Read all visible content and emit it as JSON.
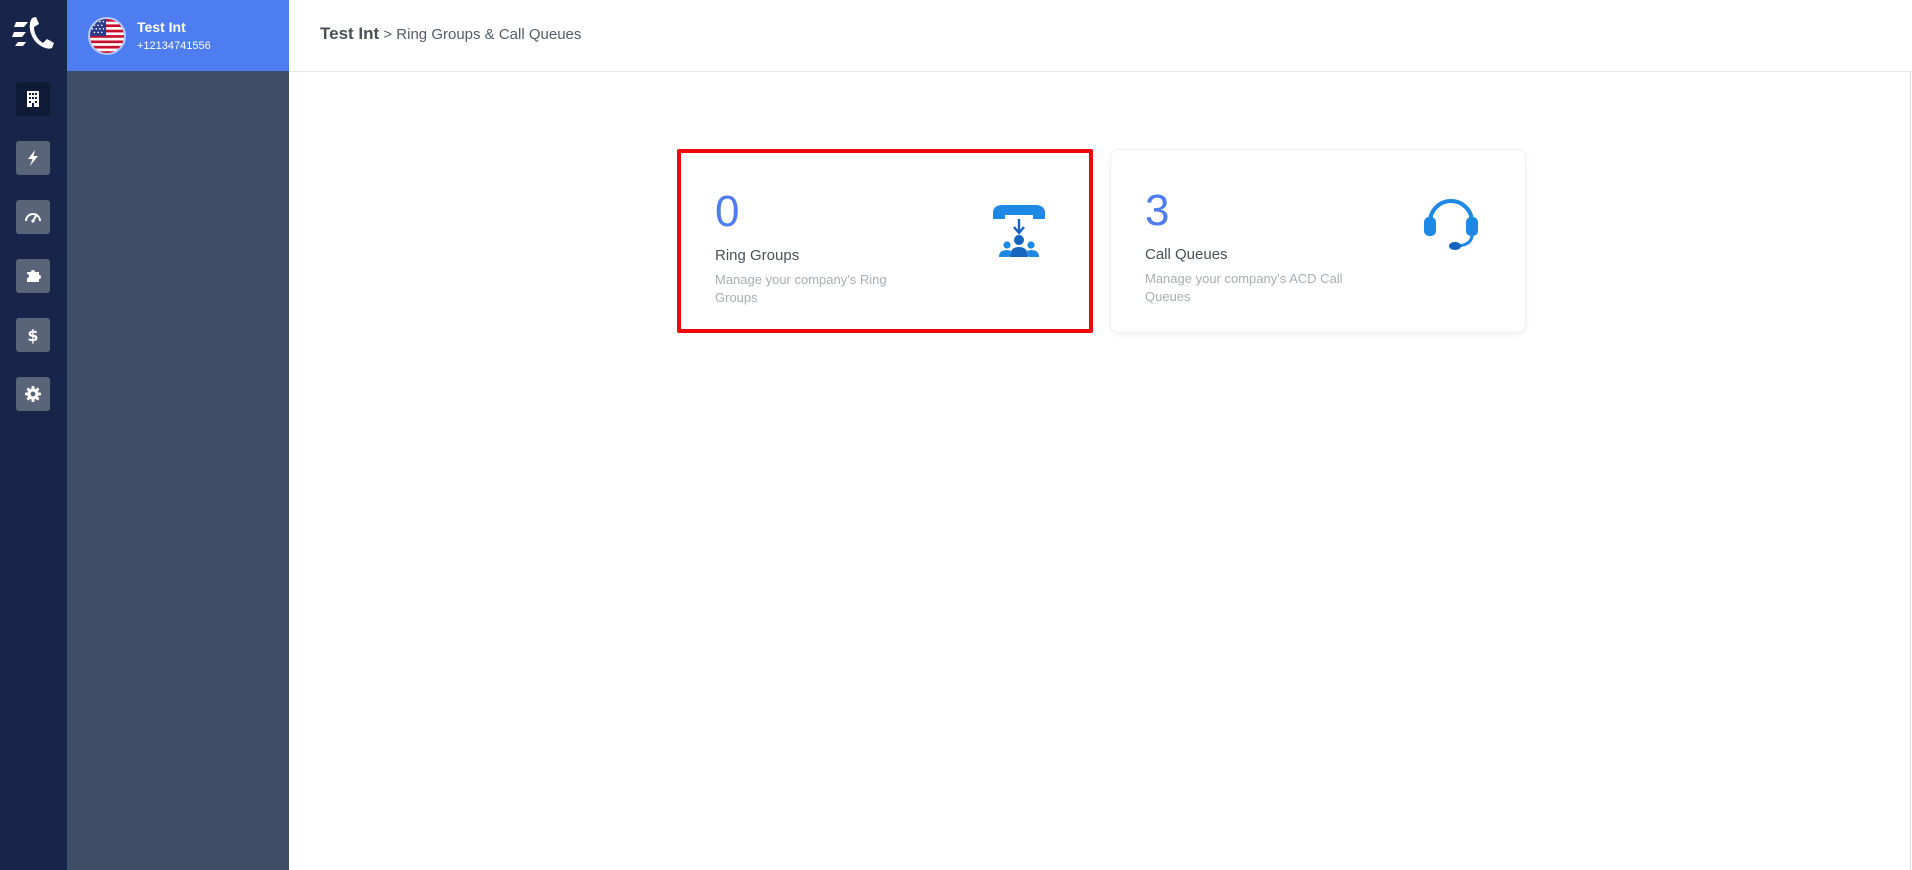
{
  "account": {
    "name": "Test Int",
    "phone": "+12134741556"
  },
  "breadcrumb": {
    "root": "Test Int",
    "separator": " > ",
    "current": "Ring Groups & Call Queues"
  },
  "rail": {
    "items": [
      {
        "icon": "building-icon",
        "active": true
      },
      {
        "icon": "lightning-icon",
        "active": false
      },
      {
        "icon": "speedometer-icon",
        "active": false
      },
      {
        "icon": "puzzle-icon",
        "active": false
      },
      {
        "icon": "dollar-icon",
        "active": false
      },
      {
        "icon": "gear-icon",
        "active": false
      }
    ]
  },
  "cards": [
    {
      "count": "0",
      "title": "Ring Groups",
      "description": "Manage your company's Ring Groups",
      "icon": "ring-group-icon",
      "highlighted": true
    },
    {
      "count": "3",
      "title": "Call Queues",
      "description": "Manage your company's ACD Call Queues",
      "icon": "headset-icon",
      "highlighted": false
    }
  ],
  "colors": {
    "rail_bg": "#17254a",
    "sidebar_bg": "#3f4d67",
    "accent": "#4d7df0",
    "icon_blue": "#1e88e5",
    "highlight_border": "#ee0a0a"
  }
}
